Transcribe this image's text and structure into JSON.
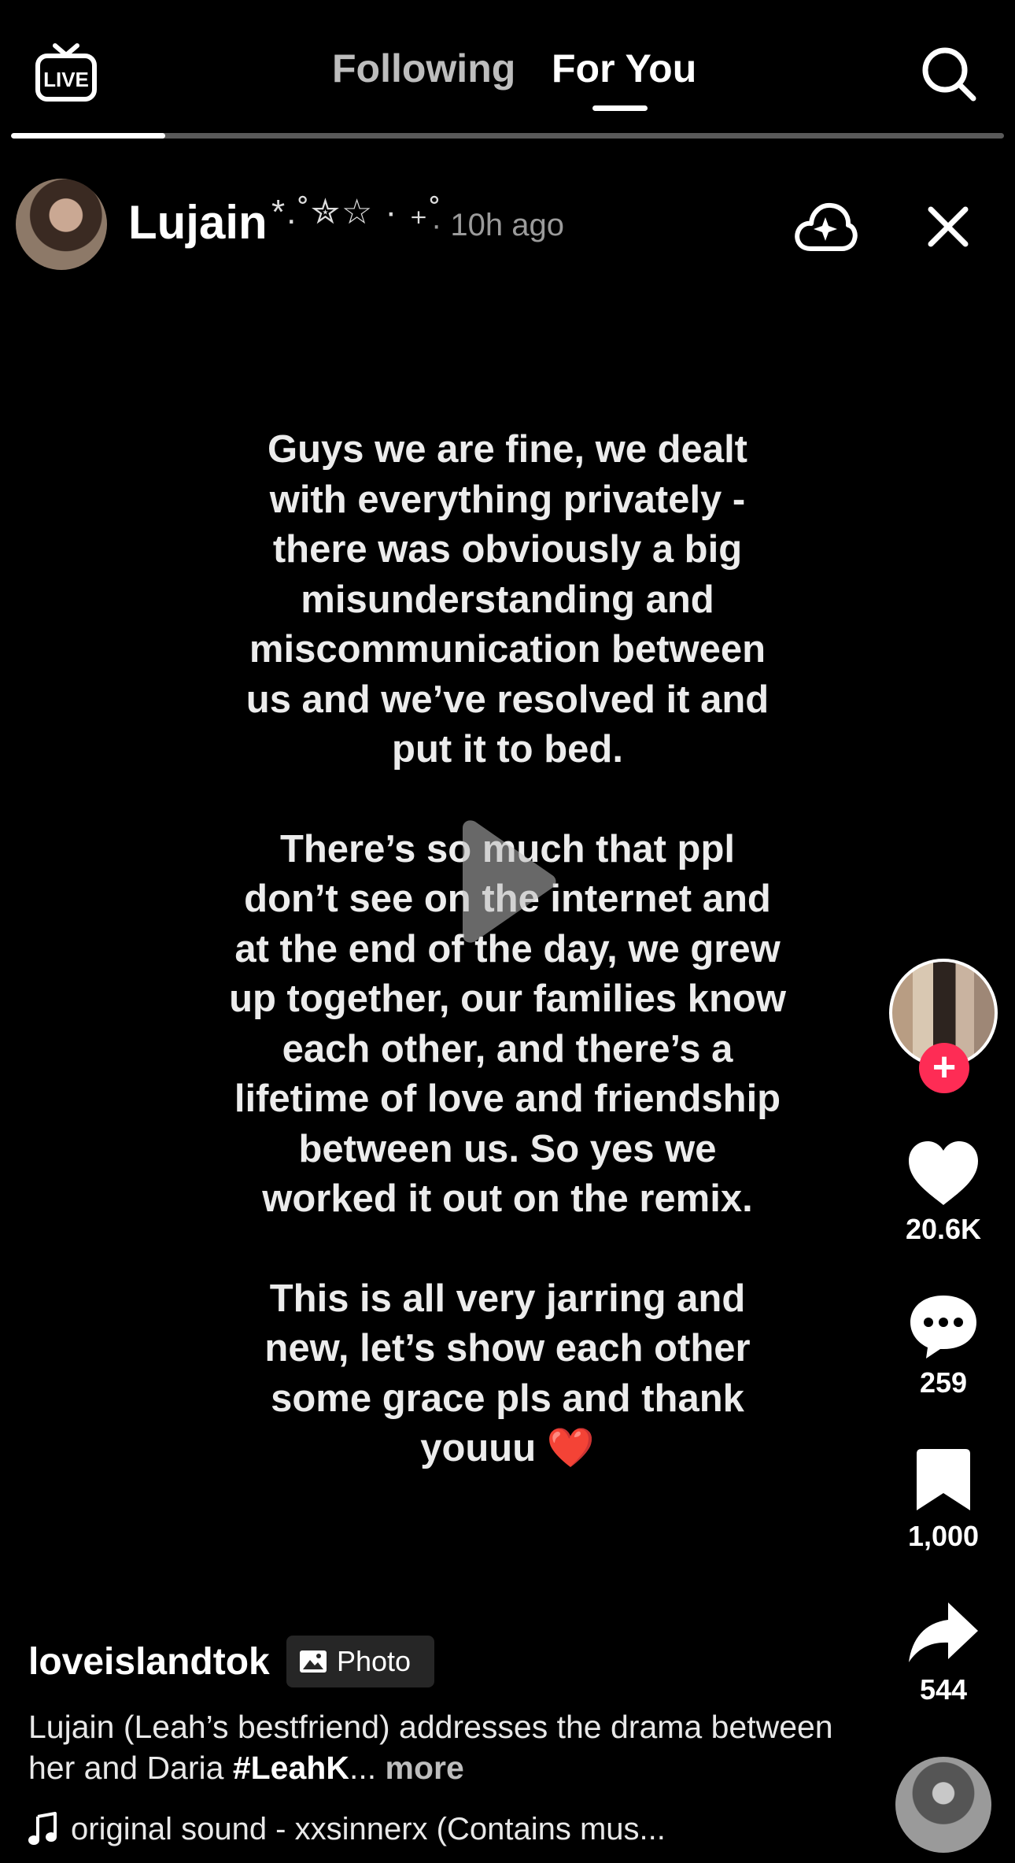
{
  "top_nav": {
    "live_icon": "live-tv-icon",
    "live_label": "LIVE",
    "tabs": [
      {
        "label": "Following",
        "active": false
      },
      {
        "label": "For You",
        "active": true
      }
    ],
    "search_icon": "search-icon"
  },
  "photo_progress": {
    "current": 1,
    "total": 6,
    "fraction": 0.155
  },
  "repost": {
    "name": "Lujain",
    "decoration": "*.˚✮☆ · ₊˚",
    "time": "· 10h ago",
    "ai_icon": "cloud-sparkle-icon",
    "close_icon": "close-icon"
  },
  "post": {
    "paragraphs": [
      "Guys we are fine, we dealt with everything privately - there was obviously a big misunderstanding and miscommunication between us and we’ve resolved it and put it to bed.",
      "There’s so much that ppl don’t see on the internet and at the end of the day, we grew up together, our families know each other, and there’s a lifetime of love and friendship between us. So yes we worked it out on the remix.",
      "This is all very jarring and new, let’s show each other some grace pls and thank youuu ❤️"
    ],
    "play_icon": "play-icon"
  },
  "rail": {
    "follow_symbol": "+",
    "likes": "20.6K",
    "comments": "259",
    "bookmarks": "1,000",
    "shares": "544",
    "icons": {
      "like": "heart-icon",
      "comment": "comment-bubble-icon",
      "bookmark": "bookmark-icon",
      "share": "share-arrow-icon"
    }
  },
  "caption": {
    "author": "loveislandtok",
    "badge_label": "Photo",
    "badge_icon": "photo-icon",
    "text": "Lujain (Leah’s bestfriend) addresses the drama between her and Daria ",
    "hashtag": "#LeahK",
    "ellipsis": "...",
    "more": "more"
  },
  "sound": {
    "icon": "music-note-icon",
    "text": "original sound - xxsinnerx (Contains mus..."
  },
  "colors": {
    "background": "#000000",
    "accent": "#fe2c55",
    "muted_text": "#9b9b9b",
    "progress_track": "#5a5a5a"
  }
}
